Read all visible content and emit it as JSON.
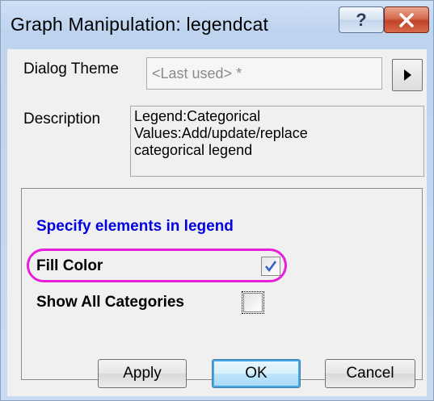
{
  "window": {
    "title": "Graph Manipulation: legendcat",
    "help_label": "?",
    "close_icon": "close-icon"
  },
  "theme": {
    "label": "Dialog Theme",
    "value": "<Last used> *",
    "arrow_icon": "triangle-right-icon"
  },
  "description": {
    "label": "Description",
    "lines": [
      "Legend:Categorical",
      "Values:Add/update/replace",
      "categorical legend"
    ]
  },
  "group": {
    "heading": "Specify elements in legend",
    "fill_color": {
      "label": "Fill Color",
      "checked": true
    },
    "show_all": {
      "label": "Show All Categories",
      "checked": false
    }
  },
  "buttons": {
    "apply": "Apply",
    "ok": "OK",
    "cancel": "Cancel"
  },
  "colors": {
    "heading": "#0000e0",
    "highlight": "#e61fd8",
    "close": "#c04328",
    "check": "#3a5fcd"
  }
}
